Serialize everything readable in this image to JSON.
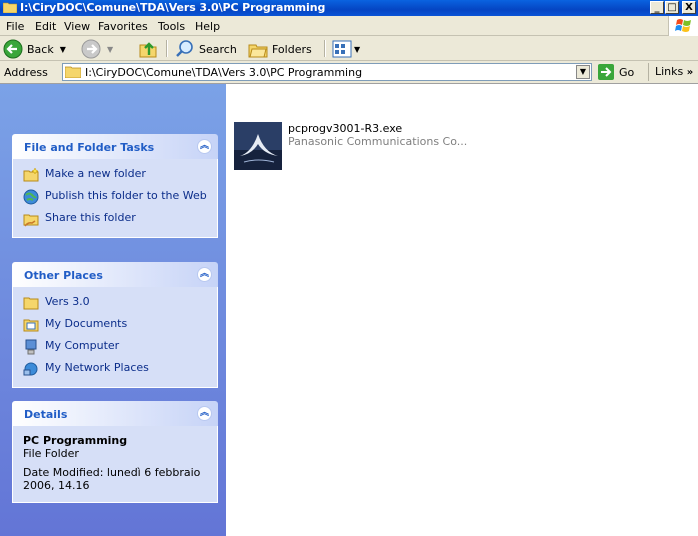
{
  "window": {
    "title": "I:\\CiryDOC\\Comune\\TDA\\Vers 3.0\\PC Programming",
    "min_label": "_",
    "max_label": "□",
    "close_label": "X"
  },
  "menu": [
    "File",
    "Edit",
    "View",
    "Favorites",
    "Tools",
    "Help"
  ],
  "toolbar": {
    "back_label": "Back",
    "search_label": "Search",
    "folders_label": "Folders"
  },
  "address": {
    "label": "Address",
    "value": "I:\\CiryDOC\\Comune\\TDA\\Vers 3.0\\PC Programming",
    "go_label": "Go",
    "links_label": "Links"
  },
  "tasks": {
    "title": "File and Folder Tasks",
    "items": [
      "Make a new folder",
      "Publish this folder to the Web",
      "Share this folder"
    ]
  },
  "places": {
    "title": "Other Places",
    "items": [
      "Vers 3.0",
      "My Documents",
      "My Computer",
      "My Network Places"
    ]
  },
  "details": {
    "title": "Details",
    "name": "PC Programming",
    "type": "File Folder",
    "modified_line1": "Date Modified: lunedì 6 febbraio",
    "modified_line2": "2006, 14.16"
  },
  "files": [
    {
      "name": "pcprogv3001-R3.exe",
      "company": "Panasonic Communications Co..."
    }
  ],
  "colors": {
    "title_bar": "#0a54d6",
    "task_pane": "#7ba2e7",
    "panel_title": "#215dc6"
  }
}
